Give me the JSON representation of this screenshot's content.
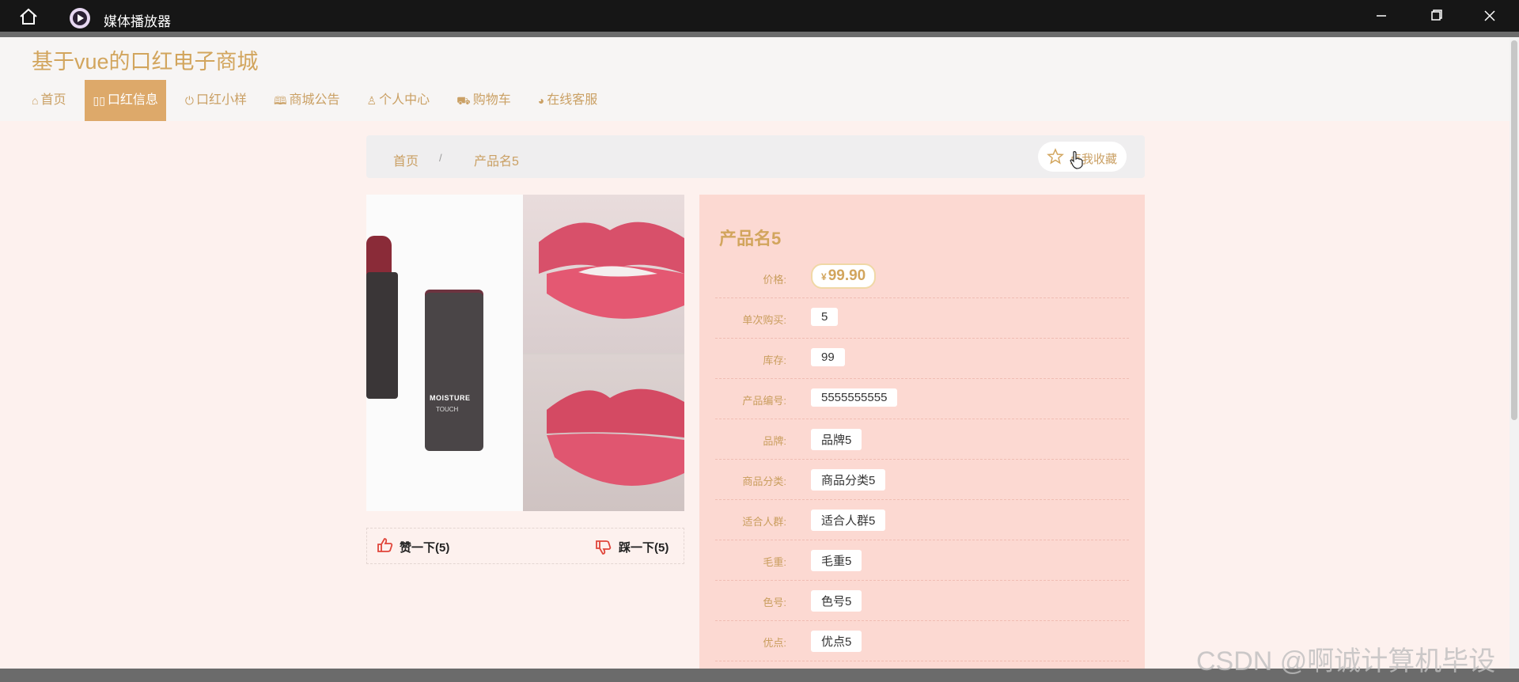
{
  "window": {
    "title": "媒体播放器",
    "icons": {
      "home": "home-icon",
      "app": "media-player-icon",
      "minimize": "minimize-icon",
      "maximize": "maximize-icon",
      "close": "close-icon"
    }
  },
  "site": {
    "title": "基于vue的口红电子商城",
    "nav": [
      {
        "label": "首页",
        "icon": "home-icon"
      },
      {
        "label": "口红信息",
        "icon": "grid-icon",
        "active": true
      },
      {
        "label": "口红小样",
        "icon": "power-icon"
      },
      {
        "label": "商城公告",
        "icon": "book-icon"
      },
      {
        "label": "个人中心",
        "icon": "user-icon"
      },
      {
        "label": "购物车",
        "icon": "cart-icon"
      },
      {
        "label": "在线客服",
        "icon": "chat-icon"
      }
    ],
    "accent": "#d2a55d"
  },
  "breadcrumb": {
    "home": "首页",
    "separator": "/",
    "current": "产品名5"
  },
  "favorite": {
    "label": "点我收藏",
    "icon": "star-icon"
  },
  "votes": {
    "like": "赞一下(5)",
    "dislike": "踩一下(5)"
  },
  "product": {
    "name": "产品名5",
    "price_currency": "¥",
    "price": "99.90",
    "fields": [
      {
        "label": "单次购买:",
        "value": "5"
      },
      {
        "label": "库存:",
        "value": "99"
      },
      {
        "label": "产品编号:",
        "value": "5555555555"
      },
      {
        "label": "品牌:",
        "value": "品牌5"
      },
      {
        "label": "商品分类:",
        "value": "商品分类5"
      },
      {
        "label": "适合人群:",
        "value": "适合人群5"
      },
      {
        "label": "毛重:",
        "value": "毛重5"
      },
      {
        "label": "色号:",
        "value": "色号5"
      },
      {
        "label": "优点:",
        "value": "优点5"
      }
    ],
    "price_label": "价格:",
    "image_text": {
      "brand": "MOISTURE",
      "sub": "TOUCH"
    }
  },
  "watermark": "CSDN @啊诚计算机毕设"
}
